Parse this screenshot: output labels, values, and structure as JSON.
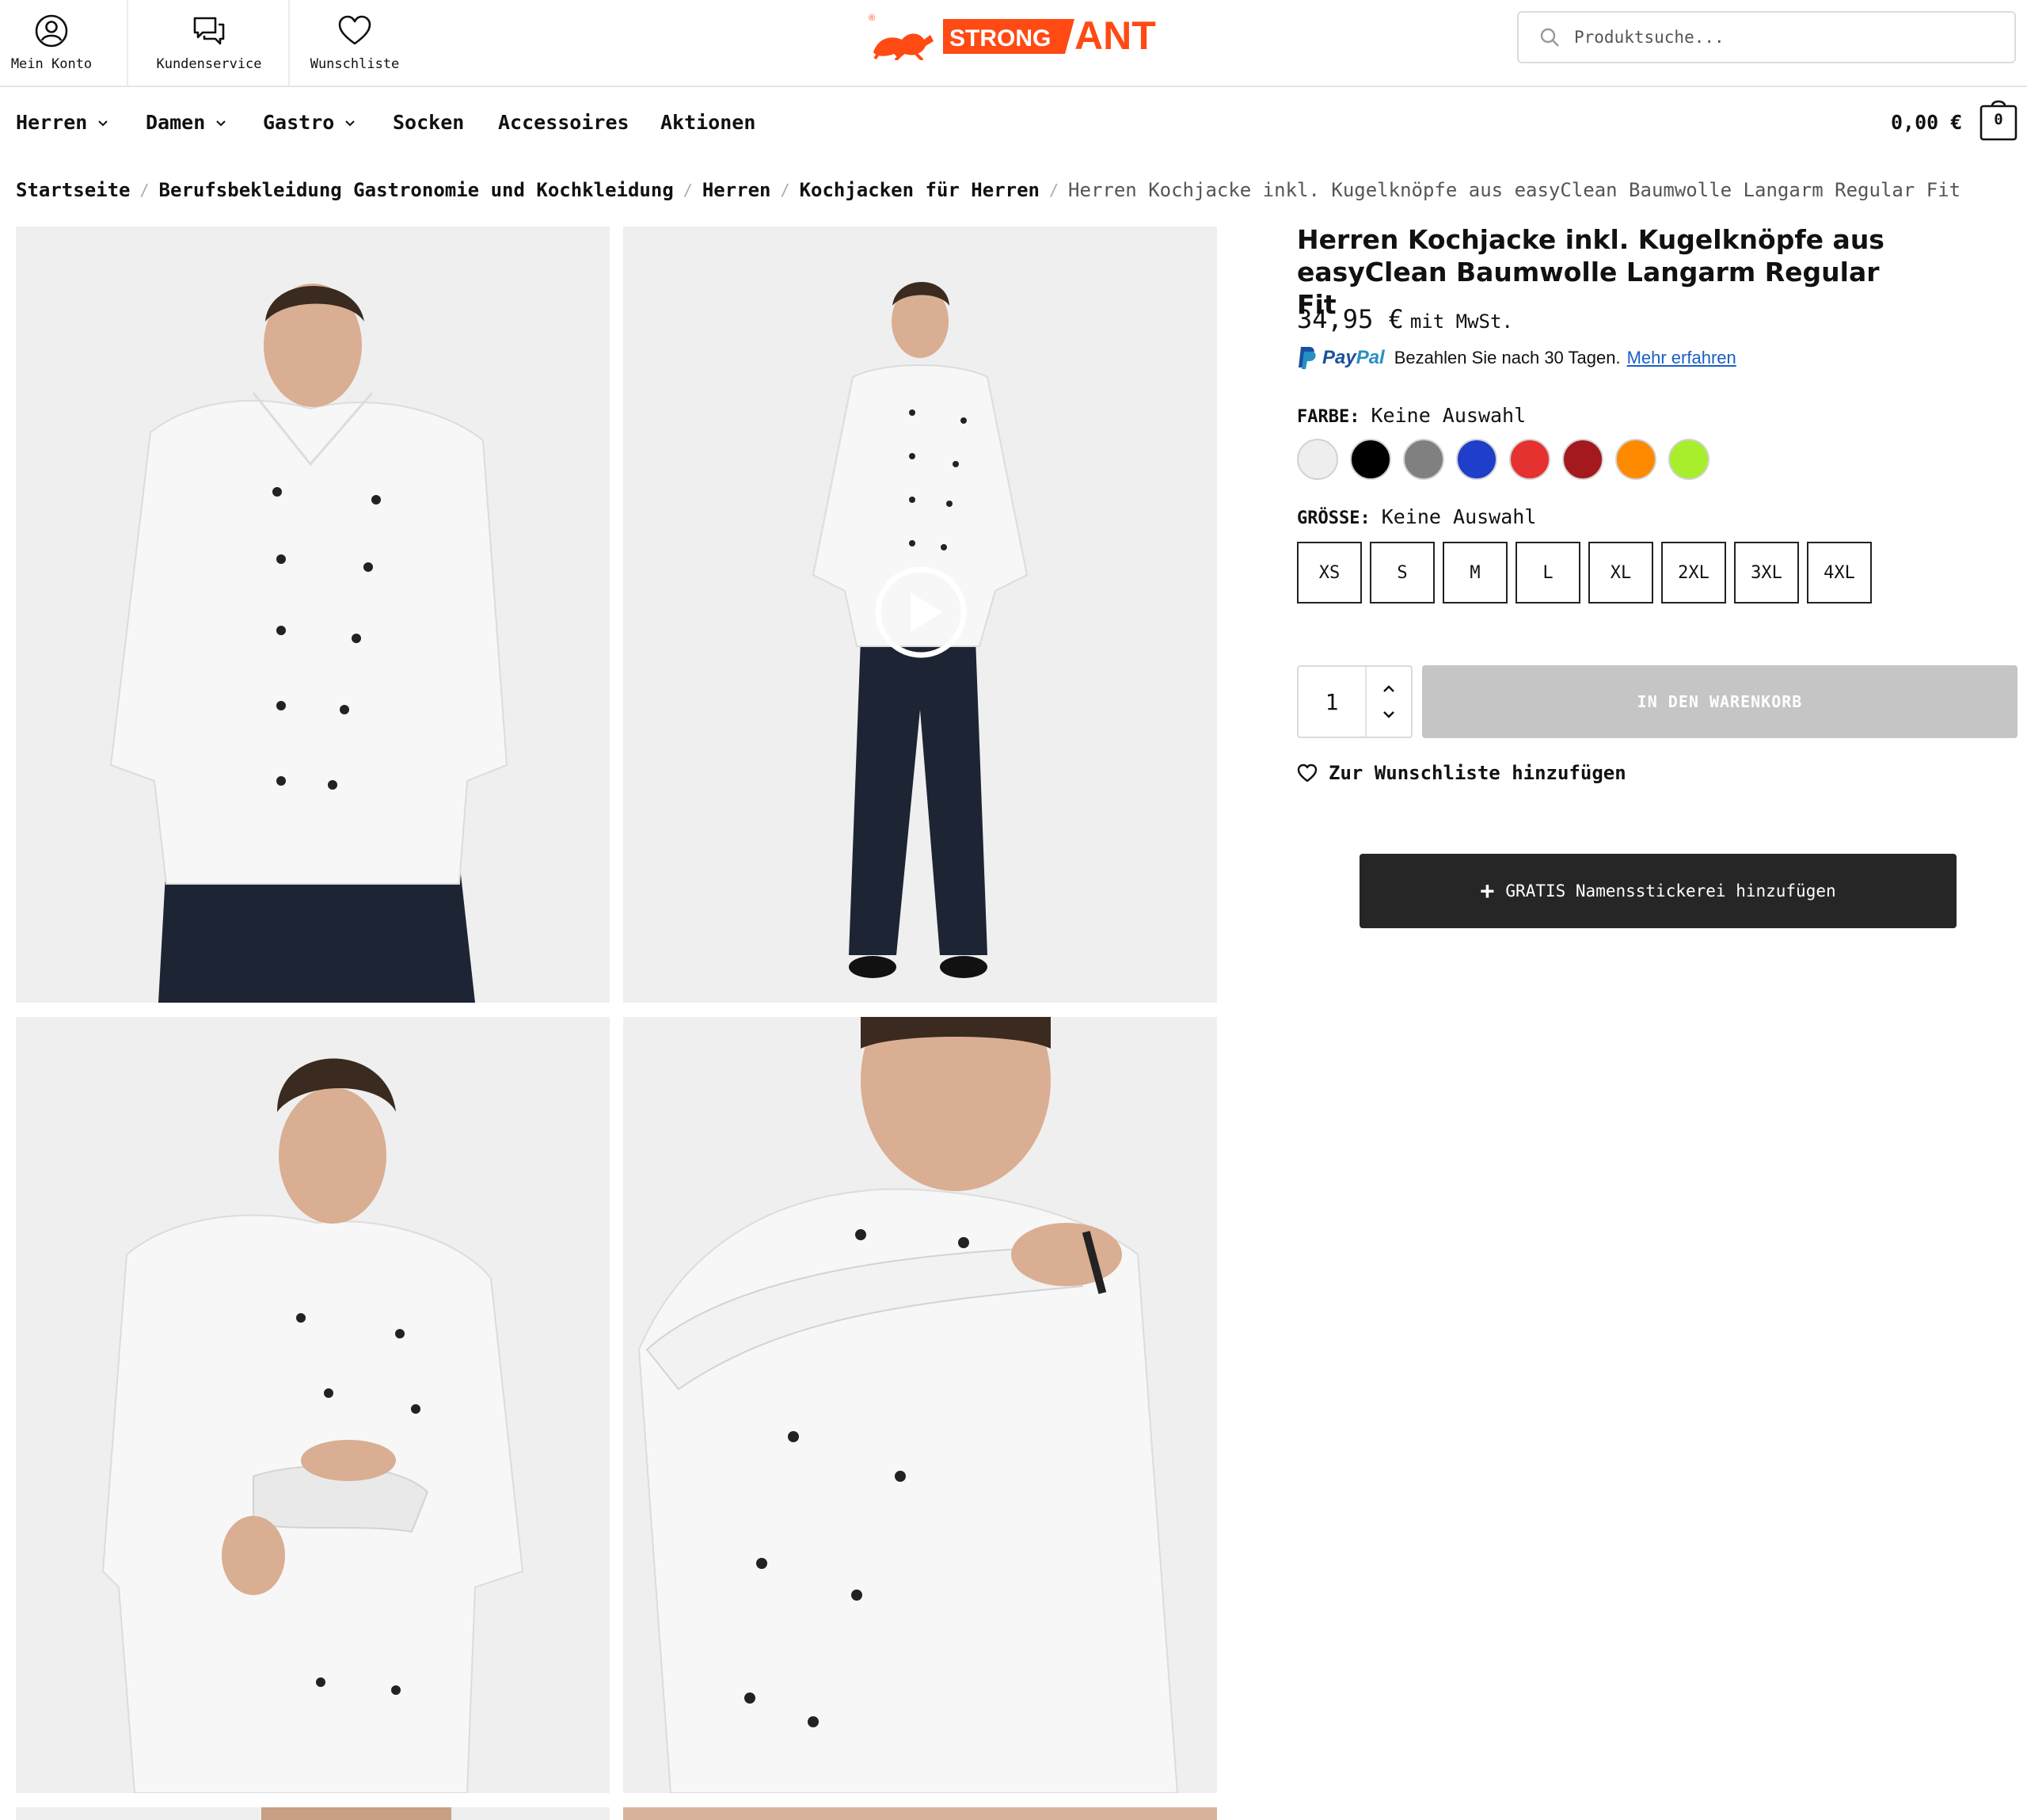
{
  "header": {
    "utility": [
      {
        "label": "Mein Konto",
        "icon": "user-circle-icon"
      },
      {
        "label": "Kundenservice",
        "icon": "chat-bubbles-icon"
      },
      {
        "label": "Wunschliste",
        "icon": "heart-icon"
      }
    ],
    "logo": {
      "text_left": "STRONG",
      "text_right": "ANT",
      "brand_color": "#ff4a14"
    },
    "search": {
      "placeholder": "Produktsuche..."
    }
  },
  "nav": {
    "items": [
      {
        "label": "Herren",
        "has_dropdown": true
      },
      {
        "label": "Damen",
        "has_dropdown": true
      },
      {
        "label": "Gastro",
        "has_dropdown": true
      },
      {
        "label": "Socken",
        "has_dropdown": false
      },
      {
        "label": "Accessoires",
        "has_dropdown": false
      },
      {
        "label": "Aktionen",
        "has_dropdown": false
      }
    ],
    "cart_total": "0,00 €",
    "cart_count": "0"
  },
  "breadcrumb": {
    "links": [
      "Startseite",
      "Berufsbekleidung Gastronomie und Kochkleidung",
      "Herren",
      "Kochjacken für Herren"
    ],
    "current": "Herren Kochjacke inkl. Kugelknöpfe aus easyClean Baumwolle Langarm Regular Fit"
  },
  "product": {
    "title": "Herren Kochjacke inkl. Kugelknöpfe aus easyClean Baumwolle Langarm Regular Fit",
    "price": "34,95 €",
    "tax_note": "mit MwSt.",
    "paypal": {
      "brand_a": "Pay",
      "brand_b": "Pal",
      "text": "Bezahlen Sie nach 30 Tagen.",
      "link": "Mehr erfahren"
    },
    "color_label": "FARBE:",
    "color_value": "Keine Auswahl",
    "colors": [
      "#eeeeee",
      "#000000",
      "#808080",
      "#1f3ec9",
      "#e5312f",
      "#a4191d",
      "#ff8a00",
      "#a8ee2d"
    ],
    "size_label": "GRÖSSE:",
    "size_value": "Keine Auswahl",
    "sizes": [
      "XS",
      "S",
      "M",
      "L",
      "XL",
      "2XL",
      "3XL",
      "4XL"
    ],
    "quantity": "1",
    "add_to_cart": "IN DEN WARENKORB",
    "wishlist": "Zur Wunschliste hinzufügen",
    "embroidery": "GRATIS Namensstickerei hinzufügen"
  },
  "gallery": {
    "video_icon": "play-icon",
    "photo_icon": "chef-jacket-photo"
  }
}
